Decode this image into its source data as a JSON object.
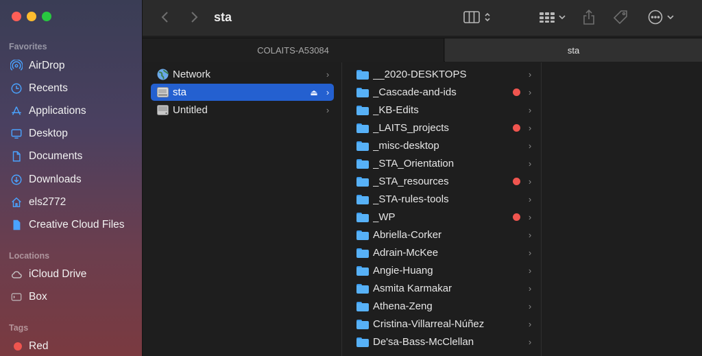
{
  "window": {
    "title": "sta"
  },
  "sidebar": {
    "favorites_label": "Favorites",
    "favorites": [
      {
        "label": "AirDrop",
        "icon": "airdrop-icon"
      },
      {
        "label": "Recents",
        "icon": "clock-icon"
      },
      {
        "label": "Applications",
        "icon": "applications-icon"
      },
      {
        "label": "Desktop",
        "icon": "desktop-icon"
      },
      {
        "label": "Documents",
        "icon": "document-icon"
      },
      {
        "label": "Downloads",
        "icon": "download-icon"
      },
      {
        "label": "els2772",
        "icon": "home-icon"
      },
      {
        "label": "Creative Cloud Files",
        "icon": "file-icon"
      }
    ],
    "locations_label": "Locations",
    "locations": [
      {
        "label": "iCloud Drive",
        "icon": "cloud-icon"
      },
      {
        "label": "Box",
        "icon": "box-icon"
      }
    ],
    "tags_label": "Tags",
    "tags": [
      {
        "label": "Red",
        "color": "#f0554f"
      }
    ]
  },
  "tabs": [
    {
      "label": "COLAITS-A53084",
      "active": false
    },
    {
      "label": "sta",
      "active": true
    }
  ],
  "column1": [
    {
      "label": "Network",
      "icon": "globe-icon"
    },
    {
      "label": "sta",
      "icon": "server-icon",
      "selected": true,
      "eject": "⏏"
    },
    {
      "label": "Untitled",
      "icon": "disk-icon"
    }
  ],
  "column2": [
    {
      "label": "__2020-DESKTOPS",
      "tag": false
    },
    {
      "label": "_Cascade-and-ids",
      "tag": true
    },
    {
      "label": "_KB-Edits",
      "tag": false
    },
    {
      "label": "_LAITS_projects",
      "tag": true
    },
    {
      "label": "_misc-desktop",
      "tag": false
    },
    {
      "label": "_STA_Orientation",
      "tag": false
    },
    {
      "label": "_STA_resources",
      "tag": true
    },
    {
      "label": "_STA-rules-tools",
      "tag": false
    },
    {
      "label": "_WP",
      "tag": true
    },
    {
      "label": "Abriella-Corker",
      "tag": false
    },
    {
      "label": "Adrain-McKee",
      "tag": false
    },
    {
      "label": "Angie-Huang",
      "tag": false
    },
    {
      "label": "Asmita Karmakar",
      "tag": false
    },
    {
      "label": "Athena-Zeng",
      "tag": false
    },
    {
      "label": "Cristina-Villarreal-Núñez",
      "tag": false
    },
    {
      "label": "De'sa-Bass-McClellan",
      "tag": false
    }
  ],
  "colors": {
    "selection": "#2460d0",
    "folder": "#57b1f7",
    "tag_red": "#f0554f"
  }
}
